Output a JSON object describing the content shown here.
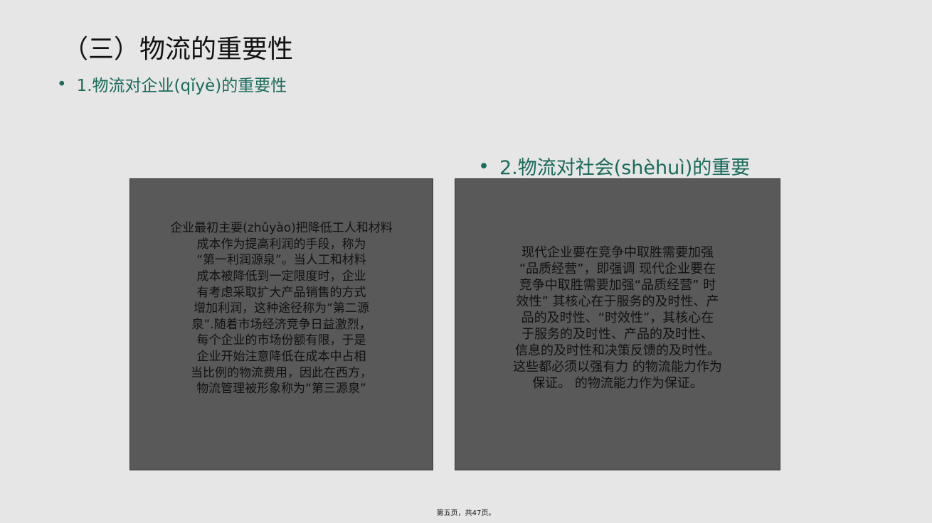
{
  "slide": {
    "title": "（三）物流的重要性",
    "bullets": [
      {
        "dot": "•",
        "text": "1.物流对企业(qǐyè)的重要性"
      },
      {
        "dot": "•",
        "text": "2.物流对社会(shèhuì)的重要"
      }
    ],
    "panels": [
      {
        "lines": [
          "企业最初主要(zhǔyào)把降低工人和材料",
          "成本作为提高利润的手段，称为",
          "“第一利润源泉”。当人工和材料",
          "成本被降低到一定限度时，企业",
          "有考虑采取扩大产品销售的方式",
          "增加利润，这种途径称为“第二源",
          "泉”.随着市场经济竞争日益激烈，",
          "每个企业的市场份额有限，于是",
          "企业开始注意降低在成本中占相",
          "当比例的物流费用，因此在西方，",
          "物流管理被形象称为“第三源泉”"
        ]
      },
      {
        "lines": [
          "现代企业要在竞争中取胜需要加强",
          "“品质经营”，即强调 现代企业要在",
          "竞争中取胜需要加强“品质经营” 时",
          "效性” 其核心在于服务的及时性、产",
          "品的及时性、“时效性”，其核心在",
          "于服务的及时性、产品的及时性、",
          "信息的及时性和决策反馈的及时性。",
          "这些都必须以强有力 的物流能力作为",
          "保证。 的物流能力作为保证。"
        ]
      }
    ],
    "footer": "第五页，共47页。"
  },
  "colors": {
    "background": "#e6e6e6",
    "accent": "#1a6b5b",
    "panel": "#595959"
  }
}
